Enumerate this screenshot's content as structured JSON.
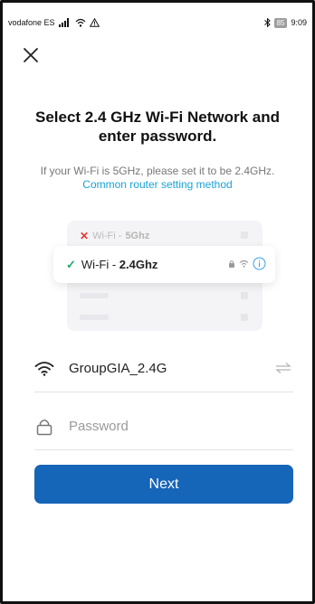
{
  "status_bar": {
    "carrier": "vodafone ES",
    "battery": "85",
    "time": "9:09"
  },
  "header": {
    "close_icon": "close-icon"
  },
  "title": "Select 2.4 GHz Wi-Fi Network and enter password.",
  "hint": {
    "text": "If your Wi-Fi is 5GHz, please set it to be 2.4GHz.",
    "link": "Common router setting method"
  },
  "illustration": {
    "bad_prefix": "Wi-Fi - ",
    "bad_band": "5Ghz",
    "good_prefix": "Wi-Fi - ",
    "good_band": "2.4Ghz"
  },
  "form": {
    "ssid": "GroupGIA_2.4G",
    "password_placeholder": "Password",
    "password_value": ""
  },
  "actions": {
    "next_label": "Next"
  },
  "colors": {
    "primary": "#1565b8",
    "link": "#1aa3d6",
    "check": "#1faa6b",
    "error": "#e53935"
  }
}
